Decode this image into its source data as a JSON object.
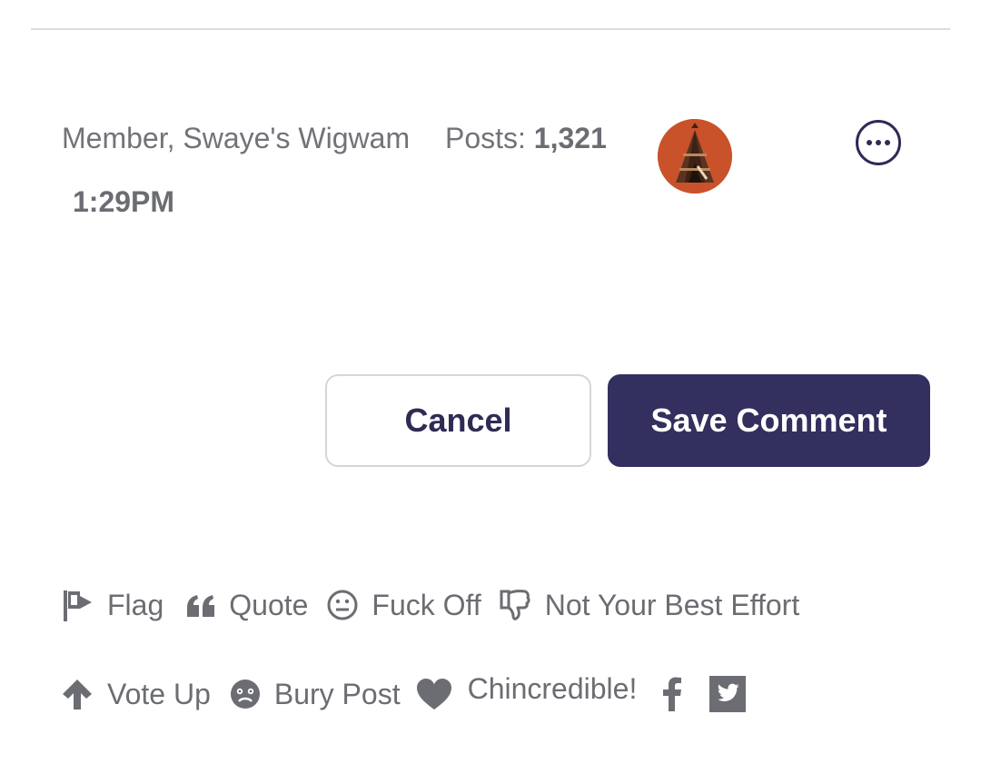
{
  "comment": {
    "member_label": "Member, Swaye's Wigwam",
    "posts_label": "Posts:",
    "posts_count": "1,321",
    "time": "1:29PM"
  },
  "form": {
    "cancel_label": "Cancel",
    "save_label": "Save Comment"
  },
  "reactions": [
    {
      "label": "Flag",
      "icon": "flag-icon"
    },
    {
      "label": "Quote",
      "icon": "quote-icon"
    },
    {
      "label": "Fuck Off",
      "icon": "neutral-face-icon"
    },
    {
      "label": "Not Your Best Effort",
      "icon": "thumbs-down-icon"
    },
    {
      "label": "Vote Up",
      "icon": "arrow-up-icon"
    },
    {
      "label": "Bury Post",
      "icon": "bury-face-icon"
    },
    {
      "label": "Chincredible!",
      "icon": "heart-icon"
    }
  ],
  "share": [
    {
      "icon": "facebook-icon"
    },
    {
      "icon": "twitter-icon"
    }
  ],
  "colors": {
    "accent": "#332f5e",
    "text": "#6b6d72",
    "avatar_bg": "#c9522b"
  }
}
